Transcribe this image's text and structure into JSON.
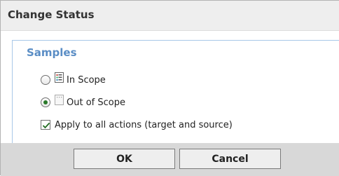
{
  "dialog": {
    "title": "Change Status"
  },
  "samples": {
    "heading": "Samples",
    "options": [
      {
        "label": "In Scope",
        "icon": "list-document-icon",
        "selected": false
      },
      {
        "label": "Out of Scope",
        "icon": "dotted-document-icon",
        "selected": true
      }
    ],
    "apply_all": {
      "label": "Apply to all actions (target and source)",
      "checked": true
    }
  },
  "footer": {
    "ok_label": "OK",
    "cancel_label": "Cancel"
  },
  "colors": {
    "heading": "#5a8dc5",
    "footer_bg": "#d8d8d8",
    "titlebar_bg": "#eeeeee"
  }
}
